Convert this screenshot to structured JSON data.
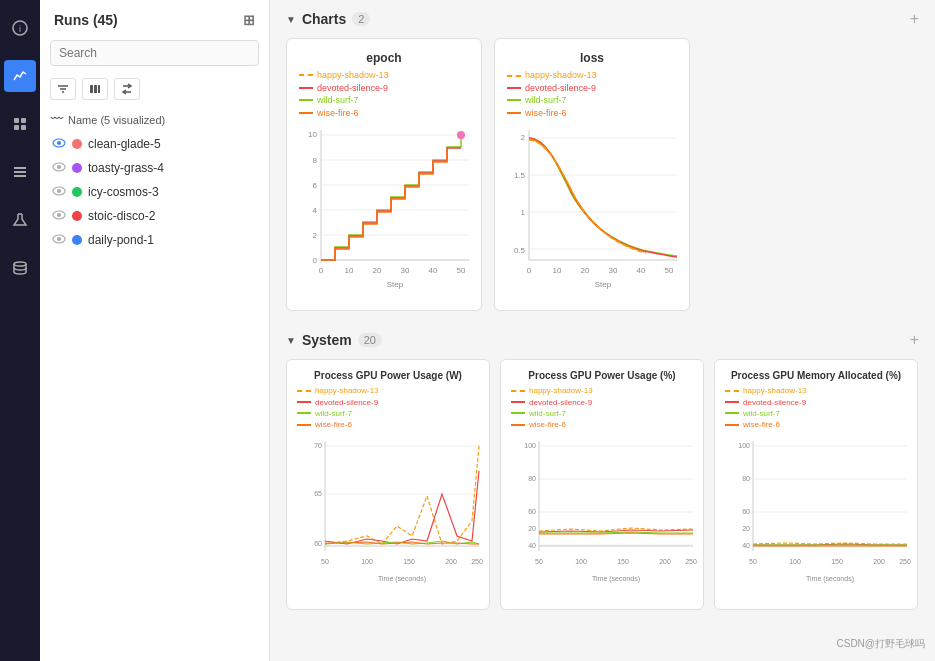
{
  "sidebar": {
    "title": "Runs (45)",
    "search_placeholder": "Search",
    "section_label": "Name (5 visualized)",
    "runs": [
      {
        "name": "clean-glade-5",
        "color": "#f87171",
        "active": true
      },
      {
        "name": "toasty-grass-4",
        "color": "#a855f7",
        "active": false
      },
      {
        "name": "icy-cosmos-3",
        "color": "#22c55e",
        "active": false
      },
      {
        "name": "stoic-disco-2",
        "color": "#ef4444",
        "active": false
      },
      {
        "name": "daily-pond-1",
        "color": "#3b82f6",
        "active": false
      }
    ]
  },
  "charts_section": {
    "title": "Charts",
    "count": "2",
    "add_label": "+"
  },
  "system_section": {
    "title": "System",
    "count": "20",
    "add_label": "+"
  },
  "charts": [
    {
      "id": "epoch",
      "title": "epoch",
      "x_label": "Step",
      "legend": [
        {
          "label": "happy-shadow-13",
          "color": "#f59e0b",
          "dashed": true
        },
        {
          "label": "devoted-silence-9",
          "color": "#ef4444",
          "dashed": false
        },
        {
          "label": "wild-surf-7",
          "color": "#84cc16",
          "dashed": false
        },
        {
          "label": "wise-fire-6",
          "color": "#f97316",
          "dashed": false
        }
      ]
    },
    {
      "id": "loss",
      "title": "loss",
      "x_label": "Step",
      "legend": [
        {
          "label": "happy-shadow-13",
          "color": "#f59e0b",
          "dashed": true
        },
        {
          "label": "devoted-silence-9",
          "color": "#ef4444",
          "dashed": false
        },
        {
          "label": "wild-surf-7",
          "color": "#84cc16",
          "dashed": false
        },
        {
          "label": "wise-fire-6",
          "color": "#f97316",
          "dashed": false
        }
      ]
    }
  ],
  "system_charts": [
    {
      "id": "gpu-power-w",
      "title": "Process GPU Power Usage (W)",
      "x_label": "Time (seconds)",
      "legend": [
        {
          "label": "happy-shadow-13",
          "color": "#f59e0b",
          "dashed": true
        },
        {
          "label": "devoted-silence-9",
          "color": "#ef4444",
          "dashed": false
        },
        {
          "label": "wild-surf-7",
          "color": "#84cc16",
          "dashed": false
        },
        {
          "label": "wise-fire-6",
          "color": "#f97316",
          "dashed": false
        }
      ]
    },
    {
      "id": "gpu-power-pct",
      "title": "Process GPU Power Usage (%)",
      "x_label": "Time (seconds)",
      "legend": [
        {
          "label": "happy-shadow-13",
          "color": "#f59e0b",
          "dashed": true
        },
        {
          "label": "devoted-silence-9",
          "color": "#ef4444",
          "dashed": false
        },
        {
          "label": "wild-surf-7",
          "color": "#84cc16",
          "dashed": false
        },
        {
          "label": "wise-fire-6",
          "color": "#f97316",
          "dashed": false
        }
      ]
    },
    {
      "id": "gpu-mem",
      "title": "Process GPU Memory Allocated (%)",
      "x_label": "Time (seconds)",
      "legend": [
        {
          "label": "happy-shadow-13",
          "color": "#f59e0b",
          "dashed": true
        },
        {
          "label": "devoted-silence-9",
          "color": "#ef4444",
          "dashed": false
        },
        {
          "label": "wild-surf-7",
          "color": "#84cc16",
          "dashed": false
        },
        {
          "label": "wise-fire-6",
          "color": "#f97316",
          "dashed": false
        }
      ]
    }
  ],
  "watermark": "CSDN@打野毛球吗"
}
